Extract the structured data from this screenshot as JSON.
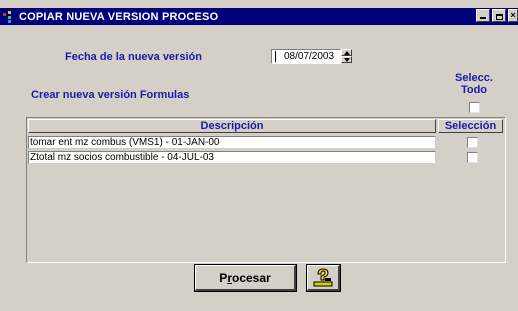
{
  "window": {
    "title": "COPIAR NUEVA VERSION PROCESO",
    "icon": "app-icon"
  },
  "form": {
    "fecha_label": "Fecha de la nueva versión",
    "fecha_value": "08/07/2003",
    "crear_label": "Crear nueva versión Formulas",
    "selecc_todo_line1": "Selecc.",
    "selecc_todo_line2": "Todo",
    "selecc_todo_checked": false
  },
  "table": {
    "columns": [
      "Descripción",
      "Selección"
    ],
    "rows": [
      {
        "descripcion": "tomar ent mz combus (VMS1) - 01-JAN-00",
        "seleccion": false
      },
      {
        "descripcion": "Ztotal mz socios combustible - 04-JUL-03",
        "seleccion": false
      }
    ]
  },
  "buttons": {
    "procesar_pre": "P",
    "procesar_underlined": "r",
    "procesar_post": "ocesar",
    "help_icon": "help-query-icon"
  },
  "colors": {
    "titlebar": "#00007a",
    "label_blue": "#1b1ba8",
    "window_bg": "#d4d0c8"
  }
}
